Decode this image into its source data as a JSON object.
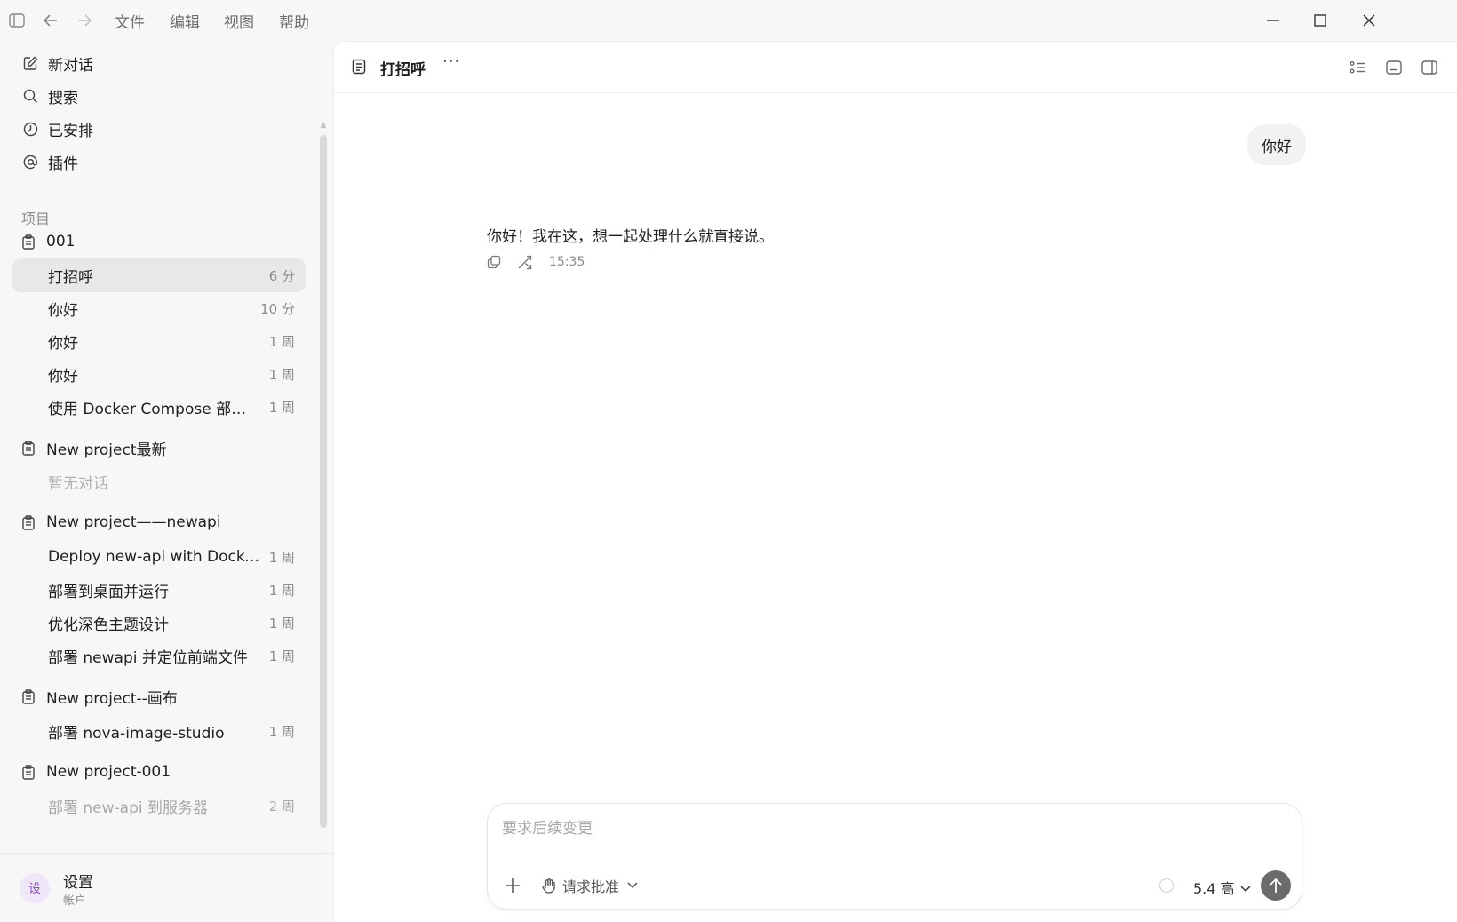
{
  "menu": [
    "文件",
    "编辑",
    "视图",
    "帮助"
  ],
  "nav": {
    "new_chat": "新对话",
    "search": "搜索",
    "scheduled": "已安排",
    "plugins": "插件"
  },
  "projects_label": "项目",
  "projects": [
    {
      "name": "001",
      "conversations": [
        {
          "title": "打招呼",
          "time": "6 分"
        },
        {
          "title": "你好",
          "time": "10 分"
        },
        {
          "title": "你好",
          "time": "1 周"
        },
        {
          "title": "你好",
          "time": "1 周"
        },
        {
          "title": "使用 Docker Compose 部署 n...",
          "time": "1 周"
        }
      ]
    },
    {
      "name": "New project最新",
      "empty": "暂无对话"
    },
    {
      "name": "New project——newapi",
      "conversations": [
        {
          "title": "Deploy new-api with Docker ...",
          "time": "1 周"
        },
        {
          "title": "部署到桌面并运行",
          "time": "1 周"
        },
        {
          "title": "优化深色主题设计",
          "time": "1 周"
        },
        {
          "title": "部署 newapi 并定位前端文件",
          "time": "1 周"
        }
      ]
    },
    {
      "name": "New project--画布",
      "conversations": [
        {
          "title": "部署 nova-image-studio",
          "time": "1 周"
        }
      ]
    },
    {
      "name": "New project-001",
      "conversations": [
        {
          "title": "部署 new-api 到服务器",
          "time": "2 周"
        }
      ]
    }
  ],
  "footer": {
    "avatar": "设",
    "settings": "设置",
    "account": "帐户"
  },
  "thread": {
    "title": "打招呼",
    "more": "···",
    "user_message": "你好",
    "assistant_message": "你好！我在这，想一起处理什么就直接说。",
    "time": "15:35"
  },
  "composer": {
    "placeholder": "要求后续变更",
    "approval": "请求批准",
    "model": "5.4 高"
  }
}
